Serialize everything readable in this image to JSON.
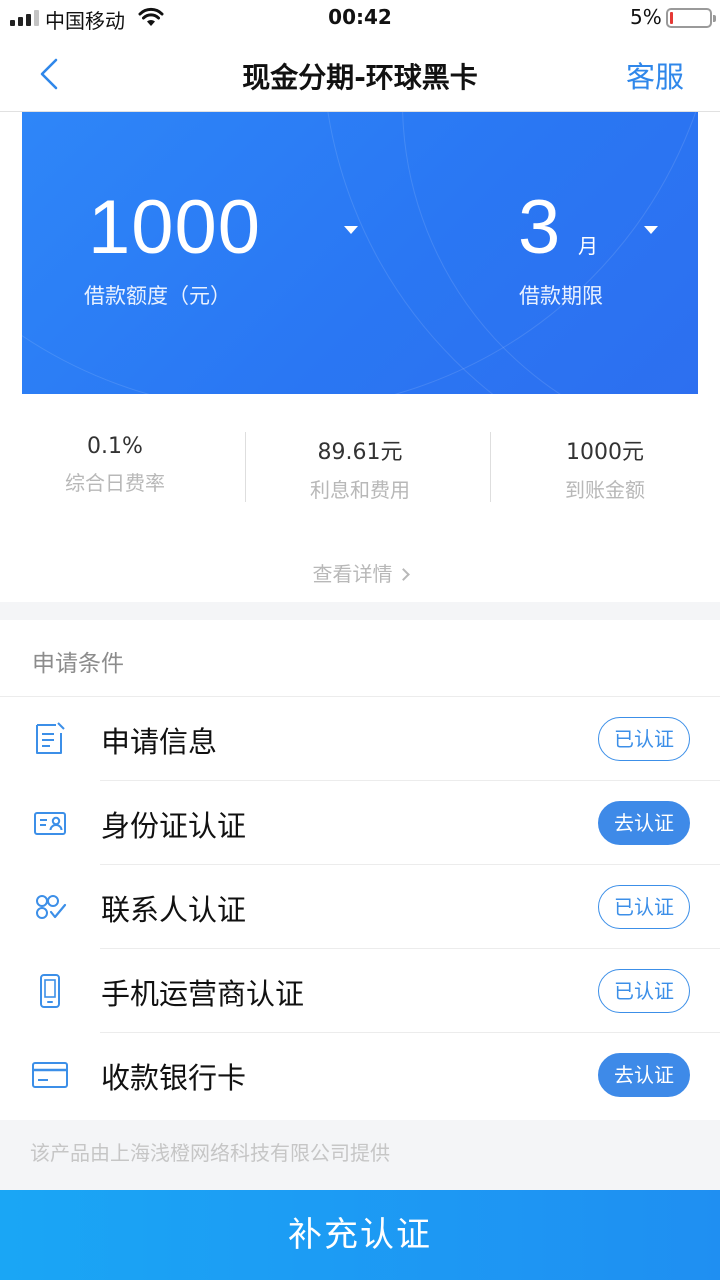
{
  "status_bar": {
    "carrier": "中国移动",
    "time": "00:42",
    "battery": "5%",
    "battery_level": 0.05
  },
  "nav": {
    "title": "现金分期-环球黑卡",
    "service_label": "客服"
  },
  "loan": {
    "amount": "1000",
    "amount_label": "借款额度（元）",
    "term": "3",
    "term_unit": "月",
    "term_label": "借款期限"
  },
  "stats": [
    {
      "value": "0.1%",
      "label": "综合日费率"
    },
    {
      "value": "89.61元",
      "label": "利息和费用"
    },
    {
      "value": "1000元",
      "label": "到账金额"
    }
  ],
  "details_label": "查看详情",
  "conditions": {
    "header": "申请条件",
    "items": [
      {
        "label": "申请信息",
        "icon": "document-edit-icon",
        "status": "已认证"
      },
      {
        "label": "身份证认证",
        "icon": "id-card-icon",
        "status": "去认证"
      },
      {
        "label": "联系人认证",
        "icon": "contacts-icon",
        "status": "已认证"
      },
      {
        "label": "手机运营商认证",
        "icon": "phone-icon",
        "status": "已认证"
      },
      {
        "label": "收款银行卡",
        "icon": "bank-card-icon",
        "status": "去认证"
      }
    ]
  },
  "footer_note": "该产品由上海浅橙网络科技有限公司提供",
  "submit_label": "补充认证",
  "colors": {
    "accent": "#2f87ea",
    "card_blue": "#2a77f3",
    "button_blue": "#1f8ff2"
  }
}
